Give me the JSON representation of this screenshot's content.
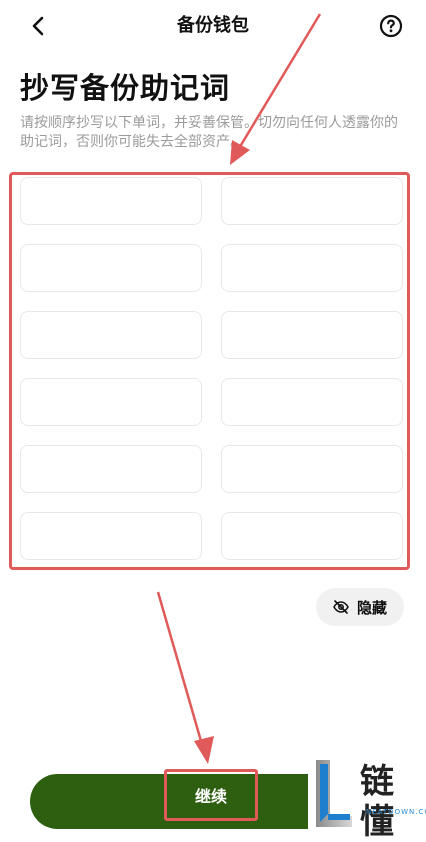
{
  "header": {
    "title": "备份钱包",
    "back_icon": "chevron-left-icon",
    "help_icon": "question-circle-icon"
  },
  "main": {
    "title": "抄写备份助记词",
    "description": "请按顺序抄写以下单词，并妥善保管。切勿向任何人透露你的助记词，否则你可能失去全部资产。",
    "word_slots": 12,
    "hide_button": {
      "label": "隐藏",
      "icon": "eye-off-icon"
    },
    "continue_button": {
      "label": "继续"
    }
  },
  "watermark": {
    "text": "链懂",
    "subtext": "NEATDOWN.COM"
  },
  "colors": {
    "accent_green": "#2e5f10",
    "annotation_red": "#e05a5a",
    "muted_text": "#9b9b9b"
  }
}
